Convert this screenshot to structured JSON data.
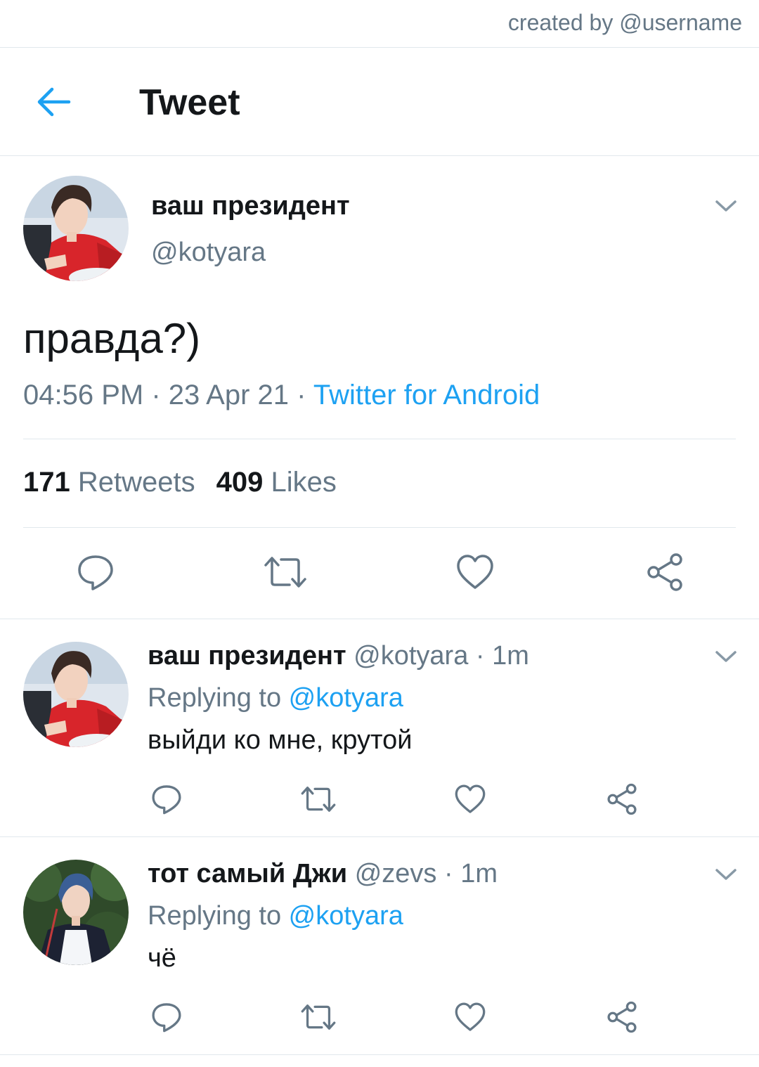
{
  "credit": "created by @username",
  "header": {
    "title": "Tweet",
    "back_icon": "back-arrow-icon"
  },
  "colors": {
    "accent": "#1da1f2",
    "muted": "#657786",
    "text": "#14171a",
    "divider": "#e1e8ed"
  },
  "main_tweet": {
    "name": "ваш президент",
    "handle": "@kotyara",
    "text": "правда?)",
    "time": "04:56 PM",
    "sep1": " · ",
    "date": "23 Apr 21",
    "sep2": " · ",
    "source": "Twitter for Android",
    "retweet_count": "171",
    "retweets_label": "Retweets",
    "like_count": "409",
    "likes_label": "Likes"
  },
  "replies": [
    {
      "name": "ваш президент",
      "handle": "@kotyara",
      "dot": " · ",
      "time": "1m",
      "replying_label": "Replying to ",
      "replying_to": "@kotyara",
      "text": "выйди ко мне, крутой"
    },
    {
      "name": "тот самый Джи",
      "handle": "@zevs",
      "dot": " · ",
      "time": "1m",
      "replying_label": "Replying to ",
      "replying_to": "@kotyara",
      "text": "чё"
    }
  ],
  "action_icons": [
    "reply-icon",
    "retweet-icon",
    "like-icon",
    "share-icon"
  ]
}
